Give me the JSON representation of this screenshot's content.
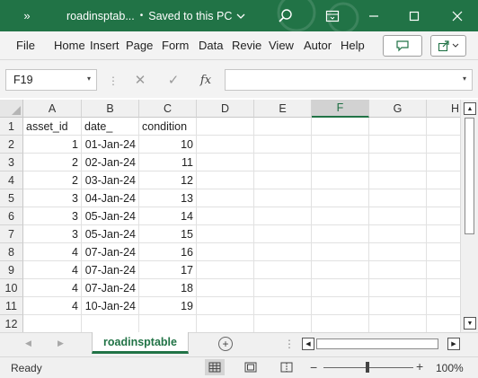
{
  "window": {
    "title": "roadinsptab...  •  Saved to this PC",
    "title_file": "roadinsptab...",
    "title_status": "Saved to this PC",
    "theme_color": "#217346"
  },
  "ribbon": {
    "tabs": [
      "File",
      "Home",
      "Insert",
      "Page",
      "Form",
      "Data",
      "Revie",
      "View",
      "Autor",
      "Help"
    ]
  },
  "formula_bar": {
    "name_box": "F19",
    "cancel_icon": "✕",
    "enter_icon": "✓",
    "fx_label": "fx",
    "formula": ""
  },
  "sheet": {
    "columns": [
      "A",
      "B",
      "C",
      "D",
      "E",
      "F",
      "G",
      "H"
    ],
    "selected_column": "F",
    "rows": [
      {
        "num": "1",
        "cells": [
          "asset_id",
          "date_",
          "condition"
        ]
      },
      {
        "num": "2",
        "cells": [
          "1",
          "01-Jan-24",
          "10"
        ]
      },
      {
        "num": "3",
        "cells": [
          "2",
          "02-Jan-24",
          "11"
        ]
      },
      {
        "num": "4",
        "cells": [
          "2",
          "03-Jan-24",
          "12"
        ]
      },
      {
        "num": "5",
        "cells": [
          "3",
          "04-Jan-24",
          "13"
        ]
      },
      {
        "num": "6",
        "cells": [
          "3",
          "05-Jan-24",
          "14"
        ]
      },
      {
        "num": "7",
        "cells": [
          "3",
          "05-Jan-24",
          "15"
        ]
      },
      {
        "num": "8",
        "cells": [
          "4",
          "07-Jan-24",
          "16"
        ]
      },
      {
        "num": "9",
        "cells": [
          "4",
          "07-Jan-24",
          "17"
        ]
      },
      {
        "num": "10",
        "cells": [
          "4",
          "07-Jan-24",
          "18"
        ]
      },
      {
        "num": "11",
        "cells": [
          "4",
          "10-Jan-24",
          "19"
        ]
      },
      {
        "num": "12",
        "cells": [
          "",
          "",
          ""
        ]
      }
    ]
  },
  "tabs_bar": {
    "active_sheet": "roadinsptable",
    "add_label": "+",
    "dots": "⋮"
  },
  "status_bar": {
    "status": "Ready",
    "zoom_minus": "−",
    "zoom_plus": "+",
    "zoom": "100%",
    "zoom_fraction": 0.5
  },
  "icons": {
    "chevrons": "»",
    "search": "search-icon",
    "ribbon_display": "ribbon-display-icon",
    "minimize": "—",
    "maximize": "☐",
    "close": "✕",
    "comment": "comment-icon",
    "share": "share-icon",
    "chevron_down": "▾"
  }
}
